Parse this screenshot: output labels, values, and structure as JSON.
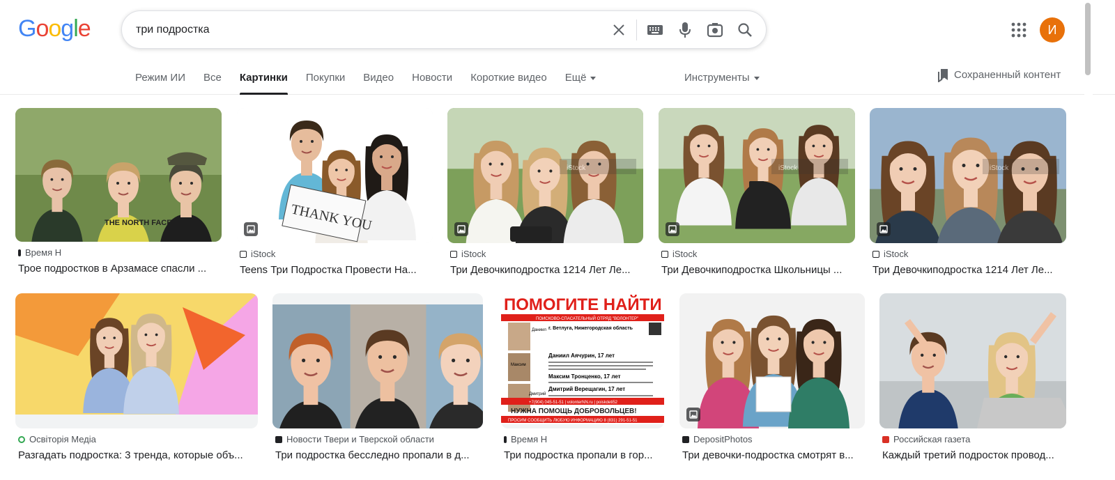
{
  "header": {
    "logo_letters": [
      "G",
      "o",
      "o",
      "g",
      "l",
      "e"
    ],
    "logo_colors": [
      "#4285F4",
      "#EA4335",
      "#FBBC05",
      "#4285F4",
      "#34A853",
      "#EA4335"
    ],
    "search_value": "три подростка",
    "avatar_letter": "И",
    "avatar_color": "#e8710a",
    "icons": [
      "clear-icon",
      "keyboard-icon",
      "mic-icon",
      "camera-icon",
      "search-icon",
      "apps-icon"
    ]
  },
  "tabs": [
    {
      "label": "Режим ИИ",
      "active": false
    },
    {
      "label": "Все",
      "active": false
    },
    {
      "label": "Картинки",
      "active": true
    },
    {
      "label": "Покупки",
      "active": false
    },
    {
      "label": "Видео",
      "active": false
    },
    {
      "label": "Новости",
      "active": false
    },
    {
      "label": "Короткие видео",
      "active": false
    },
    {
      "label": "Ещё",
      "active": false
    }
  ],
  "tools_label": "Инструменты",
  "saved_label": "Сохраненный контент",
  "results": [
    {
      "source": "Время Н",
      "title": "Трое подростков в Арзамасе спасли ...",
      "has_badge": false,
      "favicon_color": "#202124"
    },
    {
      "source": "iStock",
      "title": "Teens Три Подростка Провести На...",
      "has_badge": true,
      "favicon_color": "#202124"
    },
    {
      "source": "iStock",
      "title": "Три Девочкиподростка 1214 Лет Ле...",
      "has_badge": true,
      "favicon_color": "#202124"
    },
    {
      "source": "iStock",
      "title": "Три Девочкиподростка Школьницы ...",
      "has_badge": true,
      "favicon_color": "#202124"
    },
    {
      "source": "iStock",
      "title": "Три Девочкиподростка 1214 Лет Ле...",
      "has_badge": true,
      "favicon_color": "#202124"
    },
    {
      "source": "Освіторія Медіа",
      "title": "Разгадать подростка: 3 тренда, которые объ...",
      "has_badge": false,
      "favicon_color": "#34a853"
    },
    {
      "source": "Новости Твери и Тверской области",
      "title": "Три подростка бесследно пропали в д...",
      "has_badge": false,
      "favicon_color": "#202124"
    },
    {
      "source": "Время Н",
      "title": "Три подростка пропали в гор...",
      "has_badge": false,
      "favicon_color": "#202124"
    },
    {
      "source": "DepositPhotos",
      "title": "Три девочки-подростка смотрят в...",
      "has_badge": true,
      "favicon_color": "#202124"
    },
    {
      "source": "Российская газета",
      "title": "Каждый третий подросток провод...",
      "has_badge": false,
      "favicon_color": "#d93025"
    }
  ],
  "poster": {
    "headline": "ПОМОГИТЕ НАЙТИ",
    "org": "ПОИСКОВО-СПАСАТЕЛЬНЫЙ ОТРЯД \"ВОЛОНТЕР\"",
    "place": "г. Ветлуга, Нижегородская область",
    "names": [
      "Даниил Аячурин, 17 лет",
      "Максим Тронценко, 17 лет",
      "Дмитрий Верещагин, 17 лет"
    ],
    "labels": [
      "Даниил",
      "Максим",
      "Дмитрий"
    ],
    "contacts": "+7(904) 045-51-51 | volonterNN.ru | poiskdeti52",
    "footer": "НУЖНА ПОМОЩЬ ДОБРОВОЛЬЦЕВ!",
    "footer2": "ПРОСИМ СООБЩИТЬ ЛЮБУЮ ИНФОРМАЦИЮ 8 (831) 291-51-51"
  },
  "thumb_text": {
    "thank_you": "THANK YOU",
    "watermark": "iStock",
    "shirt": "THE NORTH FACE"
  }
}
